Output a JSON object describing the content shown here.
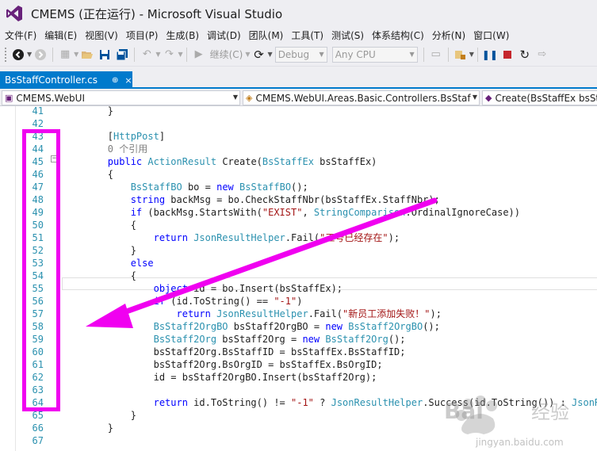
{
  "window": {
    "title": "CMEMS (正在运行) - Microsoft Visual Studio",
    "logo_icon": "visual-studio-logo-icon",
    "logo_color": "#68217a"
  },
  "menu": [
    "文件(F)",
    "编辑(E)",
    "视图(V)",
    "项目(P)",
    "生成(B)",
    "调试(D)",
    "团队(M)",
    "工具(T)",
    "测试(S)",
    "体系结构(C)",
    "分析(N)",
    "窗口(W)"
  ],
  "toolbar": {
    "continue_label": "继续(C)",
    "config_value": "Debug",
    "platform_value": "Any CPU"
  },
  "document_tab": {
    "title": "BsStaffController.cs",
    "pin": "⊕",
    "close": "×",
    "accent": "#007acc"
  },
  "navigation": {
    "project": "CMEMS.WebUI",
    "class": "CMEMS.WebUI.Areas.Basic.Controllers.BsStaf",
    "member": "Create(BsStaffEx bsSta"
  },
  "editor": {
    "line_numbers": [
      "41",
      "42",
      "43",
      "44",
      "45",
      "46",
      "47",
      "48",
      "49",
      "50",
      "51",
      "52",
      "53",
      "54",
      "55",
      "56",
      "57",
      "58",
      "59",
      "60",
      "61",
      "62",
      "63",
      "64",
      "65",
      "66",
      "67"
    ],
    "code_lines": [
      [
        {
          "t": "        }",
          "c": ""
        }
      ],
      [
        {
          "t": "",
          "c": ""
        }
      ],
      [
        {
          "t": "        [",
          "c": ""
        },
        {
          "t": "HttpPost",
          "c": "ty"
        },
        {
          "t": "]",
          "c": ""
        }
      ],
      [
        {
          "t": "        0 个引用",
          "c": "cm"
        }
      ],
      [
        {
          "t": "        ",
          "c": ""
        },
        {
          "t": "public",
          "c": "kw"
        },
        {
          "t": " ",
          "c": ""
        },
        {
          "t": "ActionResult",
          "c": "ty"
        },
        {
          "t": " Create(",
          "c": ""
        },
        {
          "t": "BsStaffEx",
          "c": "ty"
        },
        {
          "t": " bsStaffEx)",
          "c": ""
        }
      ],
      [
        {
          "t": "        {",
          "c": ""
        }
      ],
      [
        {
          "t": "            ",
          "c": ""
        },
        {
          "t": "BsStaffBO",
          "c": "ty"
        },
        {
          "t": " bo = ",
          "c": ""
        },
        {
          "t": "new",
          "c": "kw"
        },
        {
          "t": " ",
          "c": ""
        },
        {
          "t": "BsStaffBO",
          "c": "ty"
        },
        {
          "t": "();",
          "c": ""
        }
      ],
      [
        {
          "t": "            ",
          "c": ""
        },
        {
          "t": "string",
          "c": "kw"
        },
        {
          "t": " backMsg = bo.CheckStaffNbr(bsStaffEx.StaffNbr);",
          "c": ""
        }
      ],
      [
        {
          "t": "            ",
          "c": ""
        },
        {
          "t": "if",
          "c": "kw"
        },
        {
          "t": " (backMsg.StartsWith(",
          "c": ""
        },
        {
          "t": "\"EXIST\"",
          "c": "st"
        },
        {
          "t": ", ",
          "c": ""
        },
        {
          "t": "StringComparison",
          "c": "ty"
        },
        {
          "t": ".OrdinalIgnoreCase))",
          "c": ""
        }
      ],
      [
        {
          "t": "            {",
          "c": ""
        }
      ],
      [
        {
          "t": "                ",
          "c": ""
        },
        {
          "t": "return",
          "c": "kw"
        },
        {
          "t": " ",
          "c": ""
        },
        {
          "t": "JsonResultHelper",
          "c": "ty"
        },
        {
          "t": ".Fail(",
          "c": ""
        },
        {
          "t": "\"工号已经存在\"",
          "c": "st"
        },
        {
          "t": ");",
          "c": ""
        }
      ],
      [
        {
          "t": "            }",
          "c": ""
        }
      ],
      [
        {
          "t": "            ",
          "c": ""
        },
        {
          "t": "else",
          "c": "kw"
        }
      ],
      [
        {
          "t": "            {",
          "c": ""
        }
      ],
      [
        {
          "t": "                ",
          "c": ""
        },
        {
          "t": "object",
          "c": "kw"
        },
        {
          "t": " id = bo.Insert(bsStaffEx);",
          "c": ""
        }
      ],
      [
        {
          "t": "                ",
          "c": ""
        },
        {
          "t": "if",
          "c": "kw"
        },
        {
          "t": " (id.ToString() == ",
          "c": ""
        },
        {
          "t": "\"-1\"",
          "c": "st"
        },
        {
          "t": ")",
          "c": ""
        }
      ],
      [
        {
          "t": "                    ",
          "c": ""
        },
        {
          "t": "return",
          "c": "kw"
        },
        {
          "t": " ",
          "c": ""
        },
        {
          "t": "JsonResultHelper",
          "c": "ty"
        },
        {
          "t": ".Fail(",
          "c": ""
        },
        {
          "t": "\"新员工添加失败！\"",
          "c": "st"
        },
        {
          "t": ");",
          "c": ""
        }
      ],
      [
        {
          "t": "                ",
          "c": ""
        },
        {
          "t": "BsStaff2OrgBO",
          "c": "ty"
        },
        {
          "t": " bsStaff2OrgBO = ",
          "c": ""
        },
        {
          "t": "new",
          "c": "kw"
        },
        {
          "t": " ",
          "c": ""
        },
        {
          "t": "BsStaff2OrgBO",
          "c": "ty"
        },
        {
          "t": "();",
          "c": ""
        }
      ],
      [
        {
          "t": "                ",
          "c": ""
        },
        {
          "t": "BsStaff2Org",
          "c": "ty"
        },
        {
          "t": " bsStaff2Org = ",
          "c": ""
        },
        {
          "t": "new",
          "c": "kw"
        },
        {
          "t": " ",
          "c": ""
        },
        {
          "t": "BsStaff2Org",
          "c": "ty"
        },
        {
          "t": "();",
          "c": ""
        }
      ],
      [
        {
          "t": "                bsStaff2Org.BsStaffID = bsStaffEx.BsStaffID;",
          "c": ""
        }
      ],
      [
        {
          "t": "                bsStaff2Org.BsOrgID = bsStaffEx.BsOrgID;",
          "c": ""
        }
      ],
      [
        {
          "t": "                id = bsStaff2OrgBO.Insert(bsStaff2Org);",
          "c": ""
        }
      ],
      [
        {
          "t": "",
          "c": ""
        }
      ],
      [
        {
          "t": "                ",
          "c": ""
        },
        {
          "t": "return",
          "c": "kw"
        },
        {
          "t": " id.ToString() != ",
          "c": ""
        },
        {
          "t": "\"-1\"",
          "c": "st"
        },
        {
          "t": " ? ",
          "c": ""
        },
        {
          "t": "JsonResultHelper",
          "c": "ty"
        },
        {
          "t": ".Success(id.ToString()) : ",
          "c": ""
        },
        {
          "t": "JsonResu",
          "c": "ty"
        }
      ],
      [
        {
          "t": "            }",
          "c": ""
        }
      ],
      [
        {
          "t": "        }",
          "c": ""
        }
      ],
      [
        {
          "t": "",
          "c": ""
        }
      ]
    ]
  },
  "annotation": {
    "color": "#f000f0"
  },
  "watermark": {
    "brand": "Bai",
    "brand2": "经验",
    "url": "jingyan.baidu.com"
  }
}
